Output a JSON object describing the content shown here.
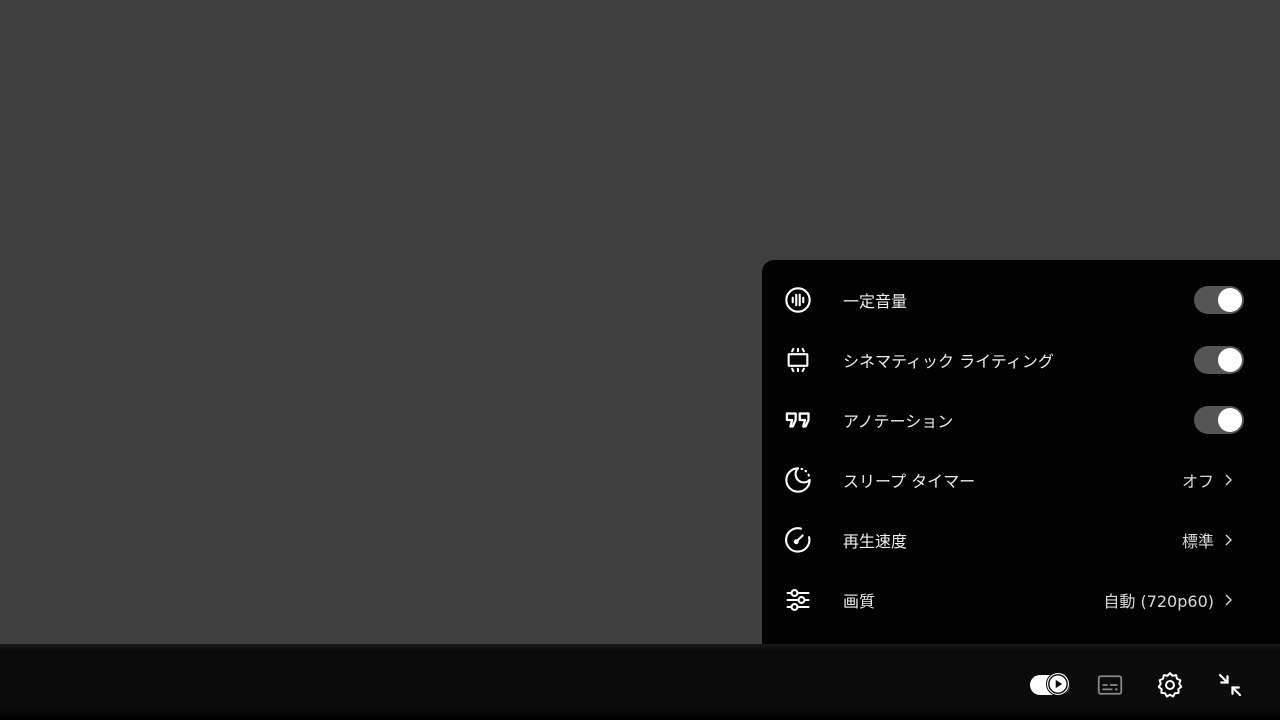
{
  "settings_menu": {
    "items": [
      {
        "id": "stable-volume",
        "label": "一定音量",
        "icon": "stable-volume-icon",
        "type": "toggle",
        "on": true
      },
      {
        "id": "ambient-mode",
        "label": "シネマティック ライティング",
        "icon": "ambient-mode-icon",
        "type": "toggle",
        "on": true
      },
      {
        "id": "annotations",
        "label": "アノテーション",
        "icon": "annotations-icon",
        "type": "toggle",
        "on": true
      },
      {
        "id": "sleep-timer",
        "label": "スリープ タイマー",
        "icon": "sleep-timer-icon",
        "type": "submenu",
        "value": "オフ"
      },
      {
        "id": "playback-speed",
        "label": "再生速度",
        "icon": "playback-speed-icon",
        "type": "submenu",
        "value": "標準"
      },
      {
        "id": "quality",
        "label": "画質",
        "icon": "quality-icon",
        "type": "submenu",
        "value": "自動 (720p60)"
      }
    ]
  },
  "controls": {
    "autoplay_on": true,
    "buttons": [
      "autoplay-toggle",
      "subtitles-button",
      "settings-button",
      "exit-fullscreen-button"
    ]
  },
  "colors": {
    "video_background": "#3f3f3f",
    "panel_background": "#000000",
    "toggle_track": "#555555",
    "toggle_knob": "#ffffff",
    "text": "#eeeeee"
  }
}
